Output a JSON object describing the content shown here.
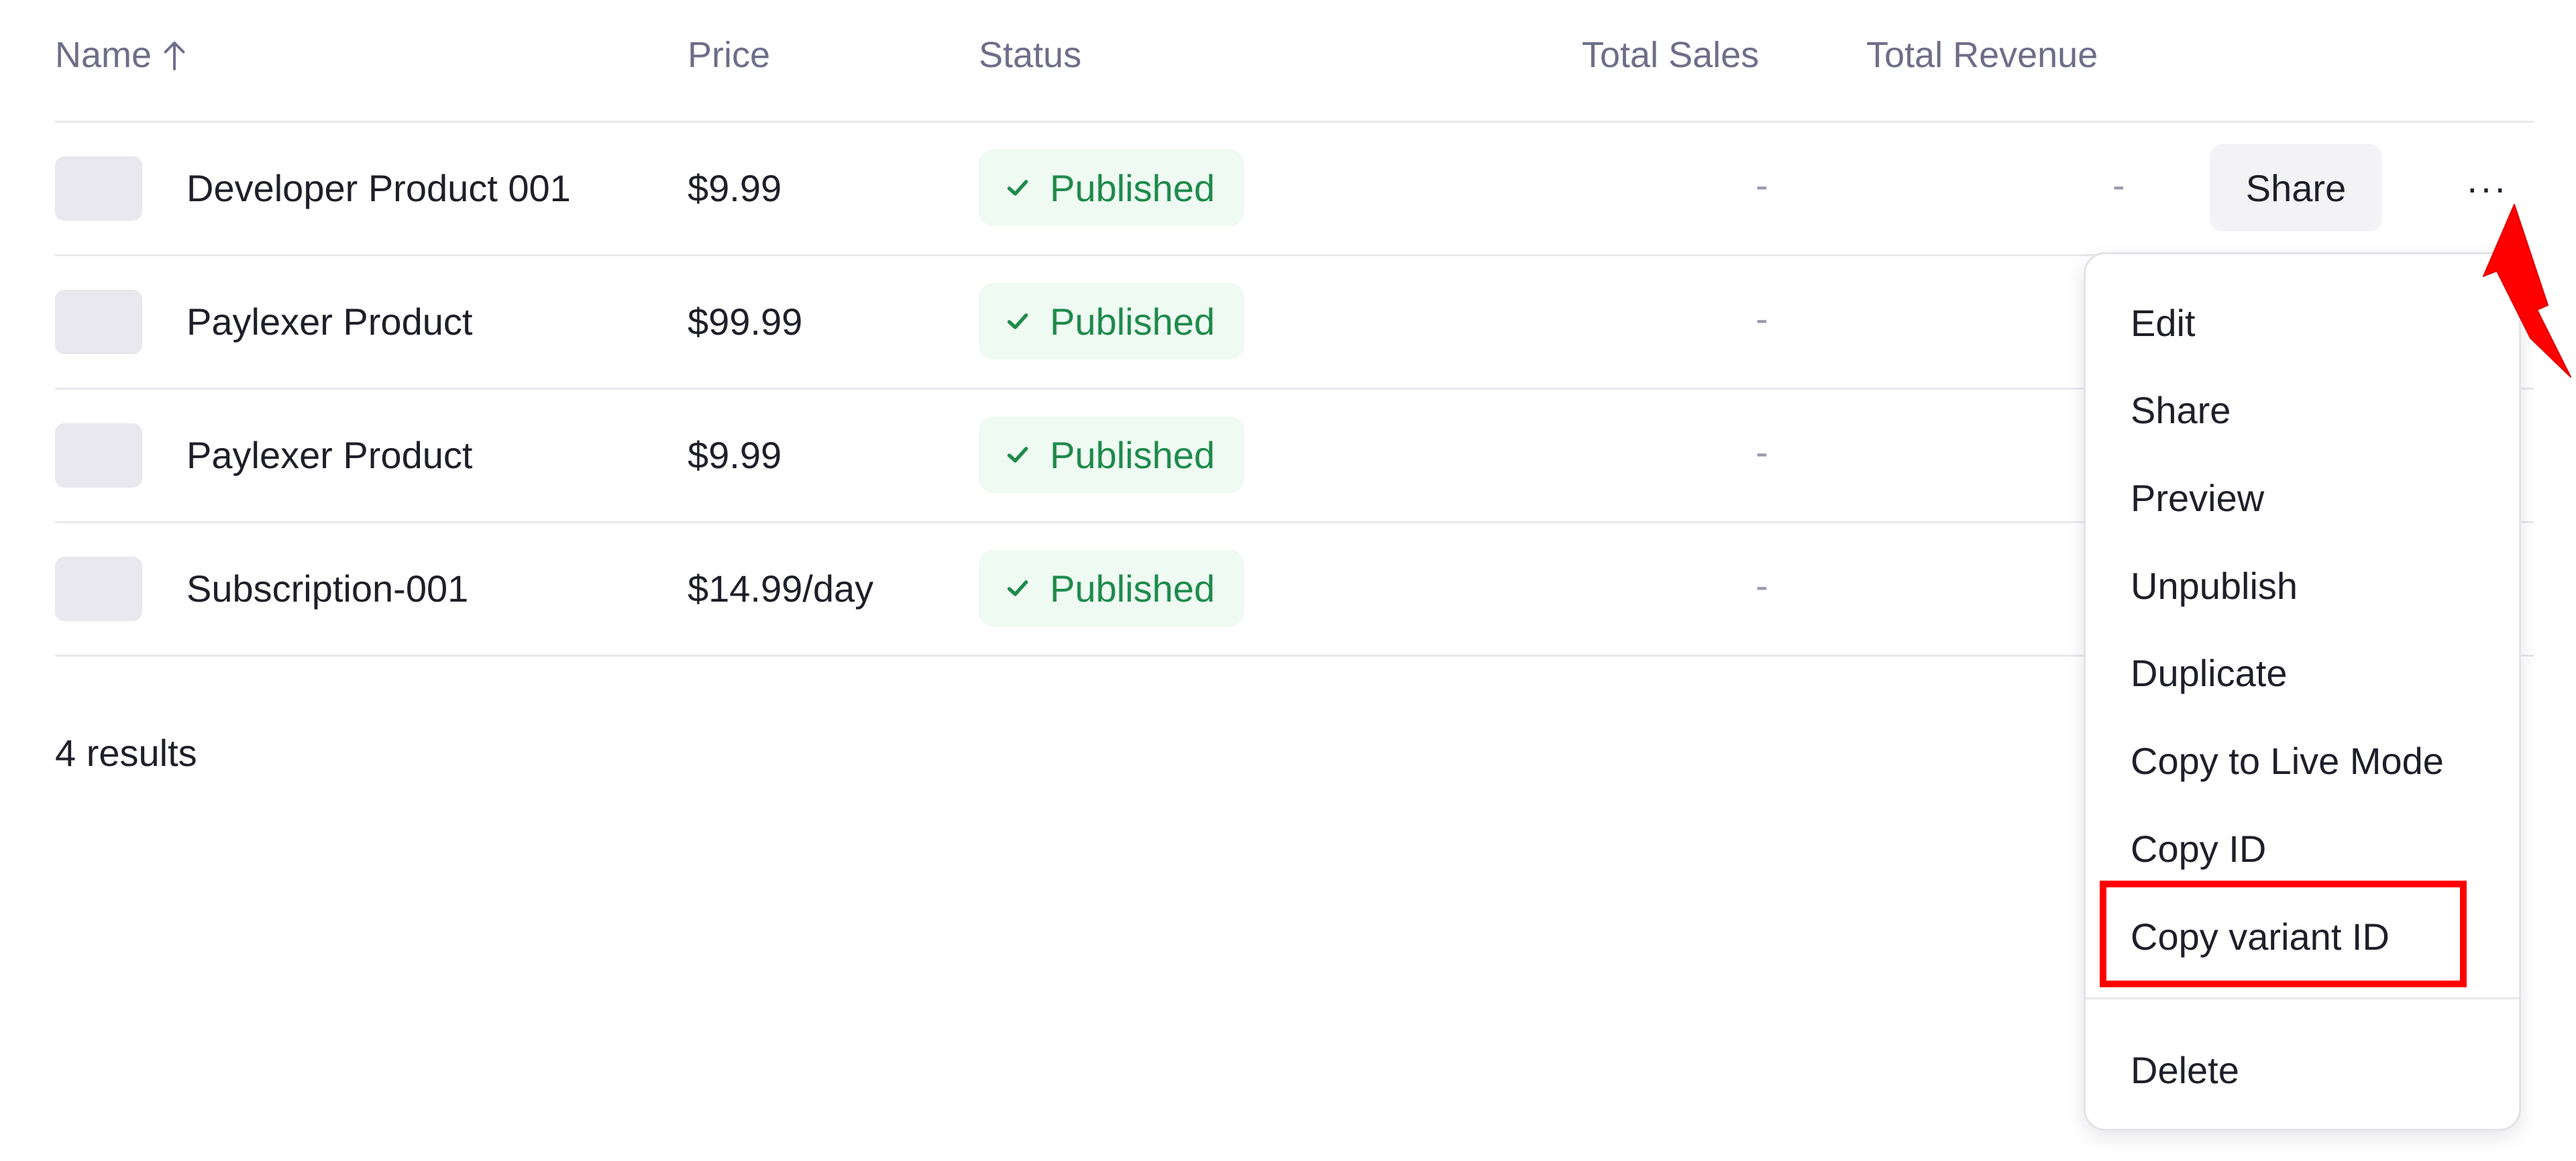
{
  "table": {
    "columns": {
      "name": "Name",
      "price": "Price",
      "status": "Status",
      "total_sales": "Total Sales",
      "total_revenue": "Total Revenue"
    },
    "rows": [
      {
        "name": "Developer Product 001",
        "price": "$9.99",
        "status": "Published",
        "sales": "-",
        "revenue": "-"
      },
      {
        "name": "Paylexer Product",
        "price": "$99.99",
        "status": "Published",
        "sales": "-"
      },
      {
        "name": "Paylexer Product",
        "price": "$9.99",
        "status": "Published",
        "sales": "-"
      },
      {
        "name": "Subscription-001",
        "price": "$14.99/day",
        "status": "Published",
        "sales": "-"
      }
    ],
    "share_label": "Share",
    "more_label": "···"
  },
  "results": "4 results",
  "menu": {
    "items": [
      "Edit",
      "Share",
      "Preview",
      "Unpublish",
      "Duplicate",
      "Copy to Live Mode",
      "Copy ID",
      "Copy variant ID",
      "Delete"
    ]
  },
  "colors": {
    "published_text": "#1f8a4c",
    "published_bg": "#eefaf2",
    "annotation": "#ff0000"
  },
  "icons": {
    "sort": "arrow-up-icon",
    "status": "check-icon",
    "more": "ellipsis-icon"
  }
}
